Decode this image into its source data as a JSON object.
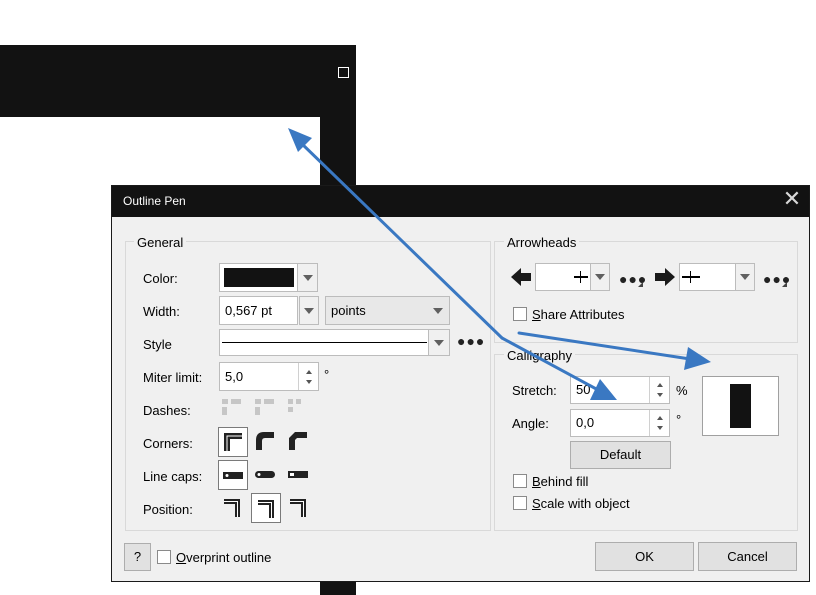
{
  "dialog": {
    "title": "Outline Pen",
    "close_glyph": "✕"
  },
  "general": {
    "group_title": "General",
    "color_label": "Color:",
    "color_value": "#121212",
    "width_label": "Width:",
    "width_value": "0,567 pt",
    "units_value": "points",
    "style_label": "Style",
    "miter_label": "Miter limit:",
    "miter_value": "5,0",
    "miter_unit": "°",
    "dashes_label": "Dashes:",
    "corners_label": "Corners:",
    "linecaps_label": "Line caps:",
    "position_label": "Position:"
  },
  "arrowheads": {
    "group_title": "Arrowheads",
    "share_prefix": "S",
    "share_rest": "hare Attributes"
  },
  "calligraphy": {
    "group_title": "Calligraphy",
    "stretch_label": "Stretch:",
    "stretch_value": "50",
    "stretch_unit": "%",
    "angle_label": "Angle:",
    "angle_value": "0,0",
    "angle_unit": "°",
    "default_label": "Default",
    "behind_prefix": "B",
    "behind_rest": "ehind fill",
    "scale_prefix": "S",
    "scale_rest": "cale with object"
  },
  "footer": {
    "help_label": "?",
    "overprint_prefix": "O",
    "overprint_rest": "verprint outline",
    "ok_label": "OK",
    "cancel_label": "Cancel"
  },
  "icons": [
    "close-icon",
    "dropdown-arrow-icon",
    "more-options-icon",
    "left-arrowhead-icon",
    "right-arrowhead-icon",
    "spin-up-icon",
    "spin-down-icon",
    "dash-icon",
    "corner-icon",
    "line-cap-icon",
    "position-icon",
    "annotation-arrow-icon"
  ],
  "colors": {
    "annotation_arrow": "#3a78c2",
    "titlebar": "#121212",
    "dialog_bg": "#f0f0f0"
  }
}
